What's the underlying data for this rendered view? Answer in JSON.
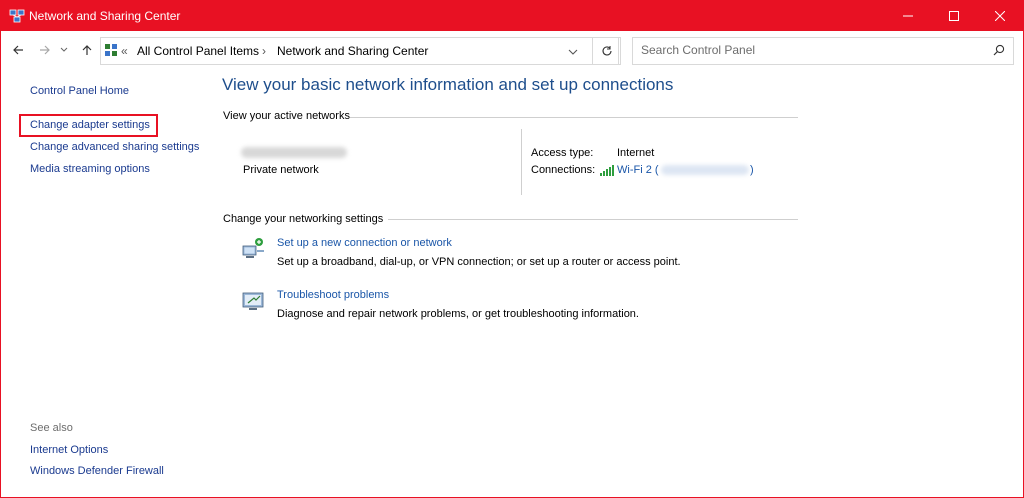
{
  "window": {
    "title": "Network and Sharing Center"
  },
  "address": {
    "separator": "«",
    "crumbs": [
      "All Control Panel Items",
      "Network and Sharing Center"
    ],
    "arrow": "›"
  },
  "search": {
    "placeholder": "Search Control Panel"
  },
  "sidebar": {
    "home": "Control Panel Home",
    "items": [
      "Change adapter settings",
      "Change advanced sharing settings",
      "Media streaming options"
    ],
    "see_also_title": "See also",
    "see_also": [
      "Internet Options",
      "Windows Defender Firewall"
    ]
  },
  "main": {
    "heading": "View your basic network information and set up connections",
    "active_title": "View your active networks",
    "network_type": "Private network",
    "access_label": "Access type:",
    "access_value": "Internet",
    "connections_label": "Connections:",
    "connection_name": "Wi-Fi 2 (",
    "connection_close": ")",
    "change_title": "Change your networking settings",
    "tasks": [
      {
        "title": "Set up a new connection or network",
        "desc": "Set up a broadband, dial-up, or VPN connection; or set up a router or access point."
      },
      {
        "title": "Troubleshoot problems",
        "desc": "Diagnose and repair network problems, or get troubleshooting information."
      }
    ]
  },
  "colors": {
    "titlebar": "#e81123",
    "link": "#1a56a8",
    "heading": "#1e4e8c"
  }
}
